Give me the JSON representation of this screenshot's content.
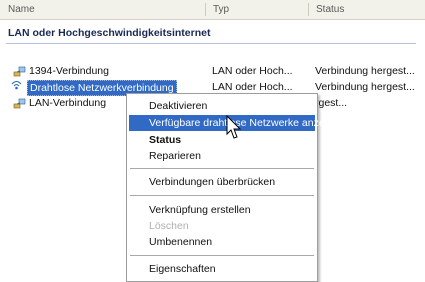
{
  "columns": {
    "name": "Name",
    "type": "Typ",
    "status": "Status"
  },
  "group": {
    "title": "LAN oder Hochgeschwindigkeitsinternet"
  },
  "connections": [
    {
      "name": "1394-Verbindung",
      "type": "LAN oder Hoch...",
      "status": "Verbindung hergest...",
      "icon": "network-connection-icon"
    },
    {
      "name": "Drahtlose Netzwerkverbindung",
      "type": "LAN oder Hoch...",
      "status": "Verbindung hergest...",
      "icon": "wireless-connection-icon",
      "selected": true
    },
    {
      "name": "LAN-Verbindung",
      "type": "",
      "status": "rgest...",
      "icon": "network-connection-icon"
    }
  ],
  "context_menu": {
    "items": [
      {
        "label": "Deaktivieren"
      },
      {
        "label": "Verfügbare drahtlose Netzwerke anzeigen",
        "highlighted": true
      },
      {
        "label": "Status",
        "bold": true
      },
      {
        "label": "Reparieren"
      },
      {
        "label": "Verbindungen überbrücken"
      },
      {
        "label": "Verknüpfung erstellen"
      },
      {
        "label": "Löschen",
        "disabled": true
      },
      {
        "label": "Umbenennen"
      },
      {
        "label": "Eigenschaften"
      }
    ]
  },
  "colors": {
    "selection": "#316ac5",
    "header_bg": "#f3f2ea",
    "group_title": "#1b2a55"
  }
}
